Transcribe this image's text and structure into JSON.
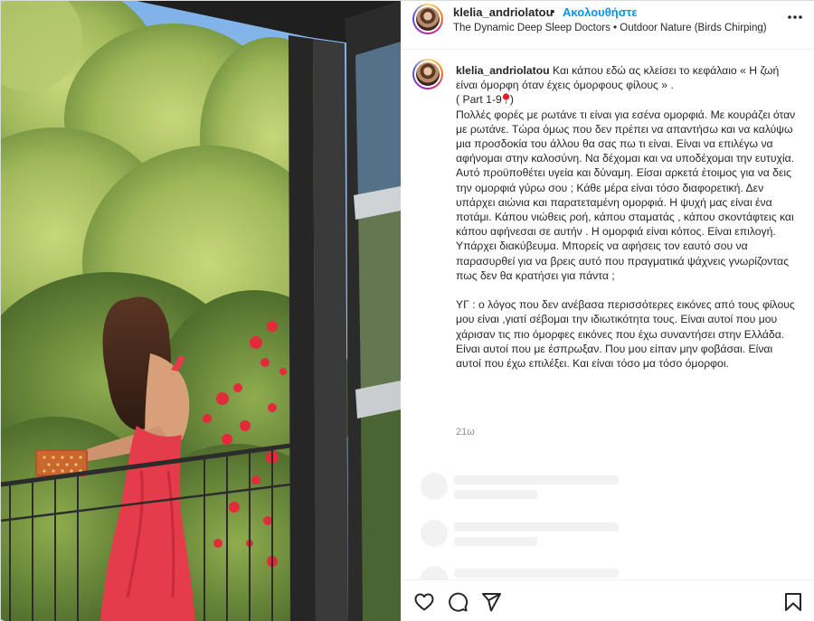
{
  "post": {
    "username": "klelia_andriolatou",
    "separator": "•",
    "follow_label": "Ακολουθήστε",
    "audio": "The Dynamic Deep Sleep Doctors • Outdoor Nature (Birds Chirping)",
    "more_icon": "more-horizontal-icon"
  },
  "caption": {
    "username": "klelia_andriolatou",
    "intro": " Και κάπου εδώ ας κλείσει το κεφάλαιο « Η ζωή είναι όμορφη όταν έχεις όμορφους φίλους » .",
    "part": "( Part 1-9",
    "part_end": ")",
    "pin_icon": "round-pushpin-icon",
    "body": "Πολλές φορές με ρωτάνε τι είναι για εσένα ομορφιά. Με κουράζει όταν με ρωτάνε. Τώρα όμως που δεν πρέπει να απαντήσω και να καλύψω μια προσδοκία του άλλου θα σας πω τι είναι. Είναι να επιλέγω να αφήνομαι στην καλοσύνη. Να δέχομαι και να υποδέχομαι την ευτυχία. Αυτό προϋποθέτει υγεία και δύναμη. Είσαι αρκετά έτοιμος για να δεις την ομορφιά γύρω σου ; Κάθε μέρα είναι τόσο διαφορετική. Δεν υπάρχει αιώνια και παρατεταμένη ομορφιά. Η ψυχή μας είναι ένα ποτάμι. Κάπου νιώθεις ροή, κάπου σταματάς , κάπου σκοντάφτεις και κάπου αφήνεσαι σε αυτήν . Η ομορφιά είναι κόπος. Είναι επιλογή. Υπάρχει διακύβευμα. Μπορείς να αφήσεις τον εαυτό σου να παρασυρθεί για να βρεις αυτό που πραγματικά ψάχνεις γνωρίζοντας πως δεν θα κρατήσει για πάντα ;",
    "ps": "ΥΓ : ο λόγος που δεν ανέβασα περισσότερες εικόνες από τους φίλους μου είναι ,γιατί σέβομαι την ιδιωτικότητα τους. Είναι αυτοί που μου χάρισαν τις πιο όμορφες εικόνες που έχω συναντήσει στην Ελλάδα. Είναι αυτοί που με έσπρωξαν. Που μου είπαν μην φοβάσαι. Είναι αυτοί που έχω επιλέξει. Και είναι τόσο μα τόσο όμορφοι.",
    "time": "21ω"
  },
  "actions": {
    "like_icon": "heart-icon",
    "comment_icon": "comment-icon",
    "share_icon": "paper-plane-icon",
    "save_icon": "bookmark-icon"
  },
  "colors": {
    "follow": "#0095f6",
    "text": "#262626",
    "muted": "#8e8e8e",
    "skeleton": "#f2f2f2",
    "dress": "#e43c4a"
  }
}
